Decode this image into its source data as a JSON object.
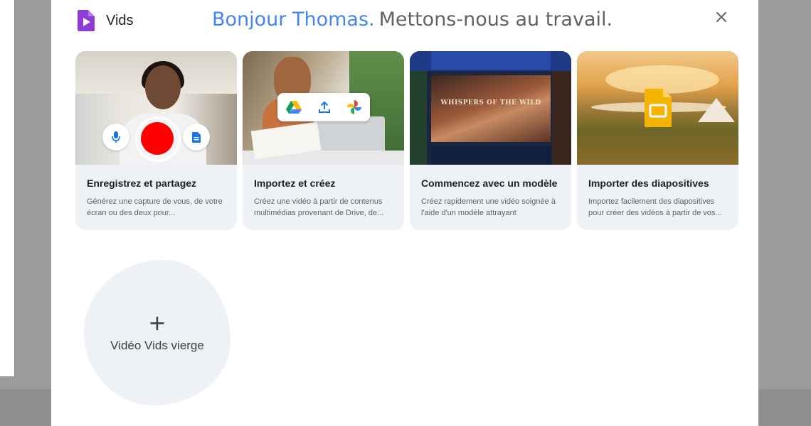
{
  "app": {
    "name": "Vids",
    "logo_icon": "vids-logo-icon",
    "accent": "#8e3bd7"
  },
  "greeting": {
    "name_part": "Bonjour Thomas.",
    "tagline": "Mettons-nous au travail."
  },
  "colors": {
    "greeting_blue": "#4285f4",
    "card_bg": "#eef1f6",
    "record_red": "#ff0000"
  },
  "cards": [
    {
      "title": "Enregistrez et partagez",
      "description": "Générez une capture de vous, de votre écran ou des deux pour...",
      "icons": [
        "microphone-icon",
        "record-button",
        "document-icon"
      ]
    },
    {
      "title": "Importez et créez",
      "description": "Créez une vidéo à partir de contenus multimédias provenant de Drive, de...",
      "icons": [
        "google-drive-icon",
        "upload-icon",
        "google-photos-icon"
      ]
    },
    {
      "title": "Commencez avec un modèle",
      "description": "Créez rapidement une vidéo soignée à l'aide d'un modèle attrayant",
      "thumbnail_text": "WHISPERS OF THE WILD"
    },
    {
      "title": "Importer des diapositives",
      "description": "Importez facilement des diapositives pour créer des vidéos à partir de vos...",
      "icons": [
        "google-slides-icon"
      ]
    }
  ],
  "blank_video": {
    "plus": "+",
    "label": "Vidéo Vids vierge"
  },
  "close_icon": "close-icon"
}
